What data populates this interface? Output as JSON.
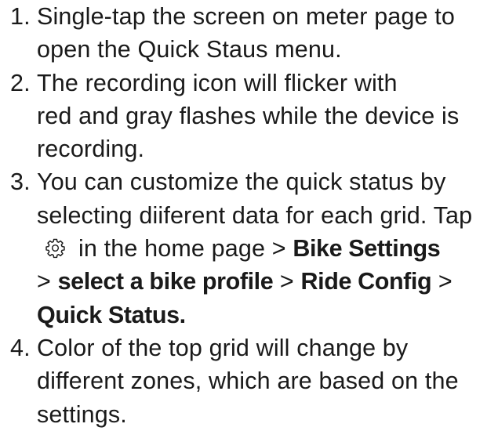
{
  "steps": [
    {
      "number": "1.",
      "lines": [
        "Single-tap the screen on meter page to",
        "open the Quick Staus menu."
      ]
    },
    {
      "number": "2.",
      "lines": [
        "The recording icon will flicker with",
        "red and gray flashes while the device is",
        "recording."
      ]
    },
    {
      "number": "3.",
      "line1": "You can customize the quick status by",
      "line2": "selecting diiferent data for each grid. Tap",
      "line3_text": "in the home page > ",
      "line3_bold": "Bike Settings",
      "line4_prefix": "> ",
      "line4_bold1": "select a bike profile",
      "line4_mid": " > ",
      "line4_bold2": "Ride Config",
      "line4_suffix": " >",
      "line5_bold": "Quick Status.",
      "icon": "gear-icon"
    },
    {
      "number": "4.",
      "lines": [
        "Color of the top grid will change by",
        "different zones, which are based on the",
        "settings."
      ]
    }
  ]
}
